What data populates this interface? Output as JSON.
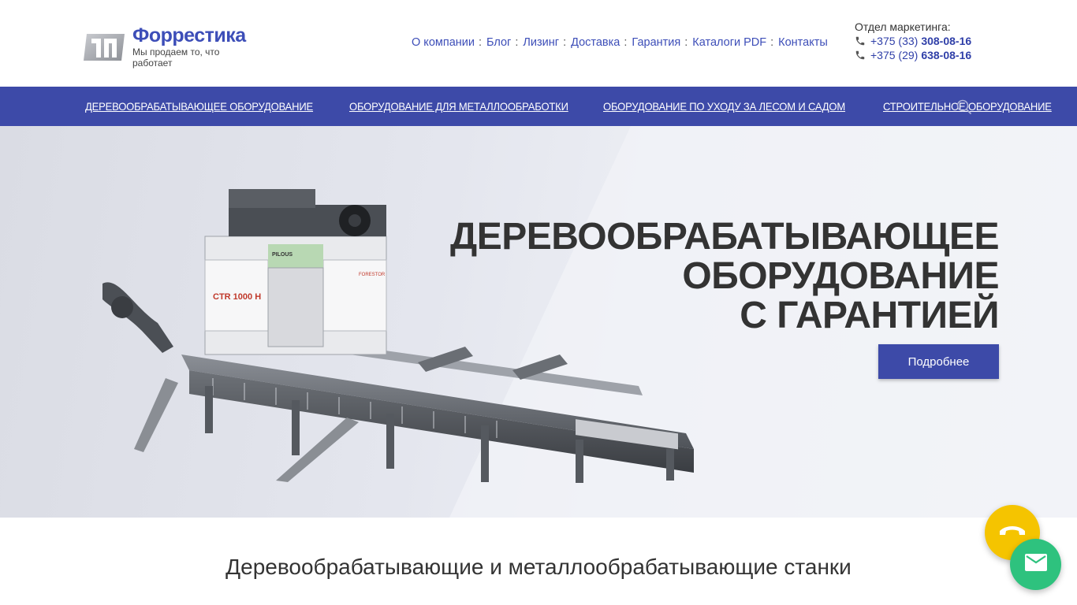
{
  "header": {
    "logo": {
      "name": "Форрестика",
      "slogan": "Мы продаем то, что работает"
    },
    "topnav": [
      {
        "label": "О компании"
      },
      {
        "label": "Блог"
      },
      {
        "label": "Лизинг"
      },
      {
        "label": "Доставка"
      },
      {
        "label": "Гарантия"
      },
      {
        "label": "Каталоги PDF"
      },
      {
        "label": "Контакты"
      }
    ],
    "topnav_separator": ":",
    "contacts": {
      "department": "Отдел маркетинга:",
      "phones": [
        {
          "code": "+375 (33)",
          "number": "308-08-16"
        },
        {
          "code": "+375 (29)",
          "number": "638-08-16"
        }
      ]
    }
  },
  "mainnav": {
    "items": [
      {
        "label": "Деревообрабатывающее оборудование"
      },
      {
        "label": "Оборудование для металлообработки"
      },
      {
        "label": "Оборудование по уходу за лесом и садом"
      },
      {
        "label": "Строительное оборудование"
      }
    ],
    "search_icon": "search-icon"
  },
  "hero": {
    "title_lines": [
      "Деревообрабатывающее",
      "оборудование",
      "с гарантией"
    ],
    "button_label": "Подробнее",
    "machine_labels": {
      "model": "CTR 1000 H",
      "brand": "PILOUS",
      "maker": "FORESTOR"
    }
  },
  "section": {
    "title": "Деревообрабатывающие и металлообрабатывающие станки"
  },
  "floating": {
    "call_icon": "phone-icon",
    "mail_icon": "mail-icon"
  },
  "colors": {
    "brand": "#3d4aa8",
    "link": "#3d4eb8",
    "call_button": "#f5c400",
    "mail_button": "#2ec27e"
  }
}
